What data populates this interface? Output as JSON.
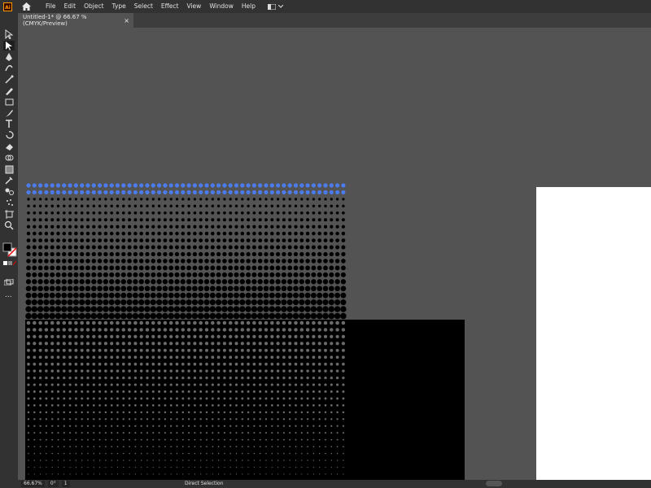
{
  "app": {
    "logo_text": "Ai"
  },
  "menu": [
    "File",
    "Edit",
    "Object",
    "Type",
    "Select",
    "Effect",
    "View",
    "Window",
    "Help"
  ],
  "document_tab": {
    "title": "Untitled-1* @ 66.67 % (CMYK/Preview)",
    "close": "×"
  },
  "toolbar": {
    "tools": [
      "selection-tool-icon",
      "direct-selection-tool-icon",
      "pen-tool-icon",
      "curvature-tool-icon",
      "magic-wand-icon",
      "pencil-tool-icon",
      "rectangle-tool-icon",
      "paintbrush-tool-icon",
      "type-tool-icon",
      "rotate-tool-icon",
      "eraser-tool-icon",
      "shape-builder-icon",
      "gradient-tool-icon",
      "eyedropper-tool-icon",
      "blend-tool-icon",
      "symbol-sprayer-icon",
      "artboard-tool-icon",
      "zoom-tool-icon"
    ],
    "selected": "direct-selection-tool-icon",
    "more": "..."
  },
  "status": {
    "zoom": "66.67%",
    "rotation": "0°",
    "artboard": "1",
    "mode": "Direct Selection"
  },
  "colors": {
    "ui_dark": "#323232",
    "canvas": "#535353",
    "selection_blue": "#4b7bec",
    "fill": "#000000"
  }
}
